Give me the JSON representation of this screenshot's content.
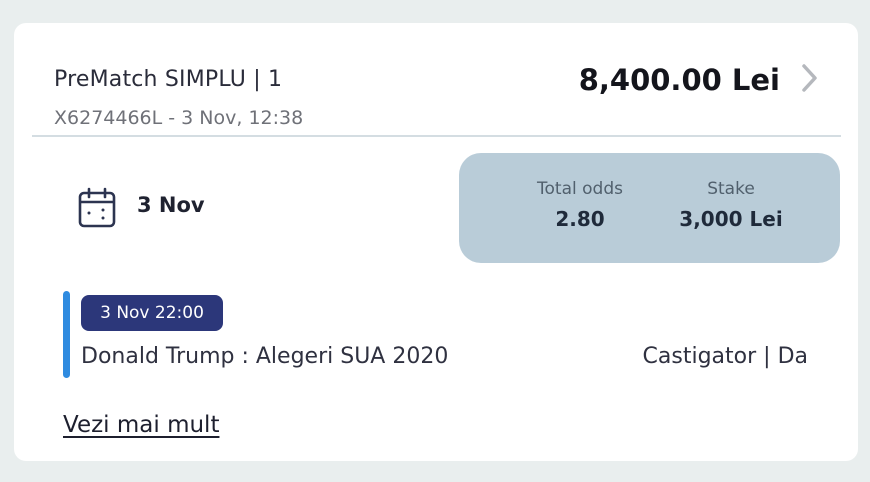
{
  "bet": {
    "title": "PreMatch SIMPLU | 1",
    "ticket_line": "X6274466L - 3 Nov, 12:38",
    "potential_win": "8,400.00 Lei",
    "date": "3 Nov"
  },
  "summary": {
    "total_odds_label": "Total odds",
    "total_odds_value": "2.80",
    "stake_label": "Stake",
    "stake_value": "3,000 Lei"
  },
  "event": {
    "time": "3 Nov 22:00",
    "name": "Donald Trump : Alegeri SUA 2020",
    "selection": "Castigator | Da"
  },
  "actions": {
    "see_more": "Vezi mai mult"
  },
  "icons": {
    "chevron": "chevron-right-icon",
    "calendar": "calendar-icon"
  },
  "colors": {
    "accent_bar": "#2f8be0",
    "badge_bg": "#2c377a",
    "odds_box_bg": "#b9ccd8"
  }
}
